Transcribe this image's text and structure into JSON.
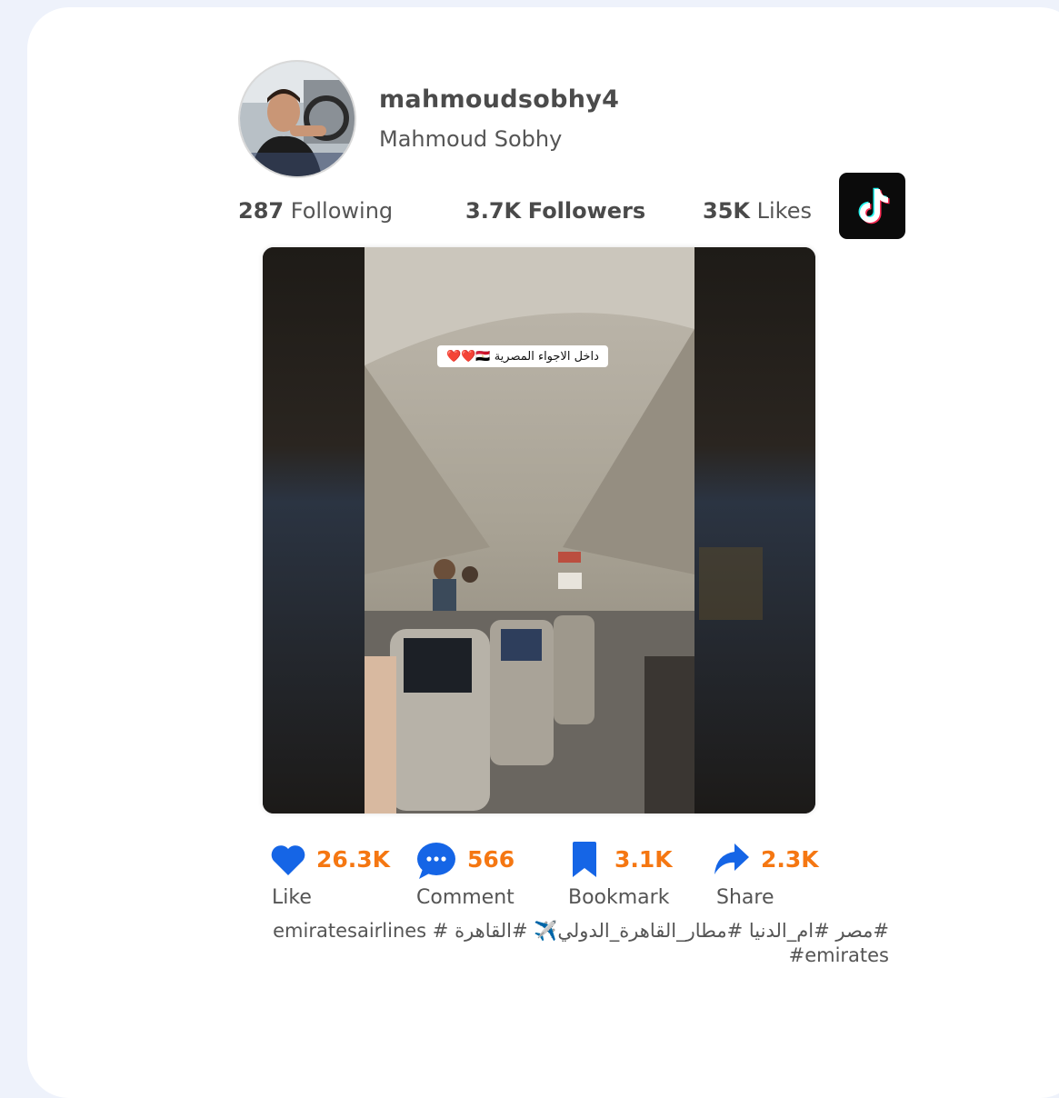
{
  "profile": {
    "username": "mahmoudsobhy4",
    "display_name": "Mahmoud Sobhy"
  },
  "stats": {
    "following_count": "287",
    "following_label": "Following",
    "followers_count": "3.7K",
    "followers_label": "Followers",
    "likes_count": "35K",
    "likes_label": "Likes"
  },
  "video": {
    "overlay_text": "داخل الاجواء المصرية 🇪🇬❤️❤️"
  },
  "metrics": {
    "like_count": "26.3K",
    "like_label": "Like",
    "comment_count": "566",
    "comment_label": "Comment",
    "bookmark_count": "3.1K",
    "bookmark_label": "Bookmark",
    "share_count": "2.3K",
    "share_label": "Share"
  },
  "description": "#مصر #ام_الدنيا #مطار_القاهرة_الدولي✈️ #القاهرة # emiratesairlines #emirates",
  "icons": {
    "like": "heart-icon",
    "comment": "speech-bubble-icon",
    "bookmark": "bookmark-icon",
    "share": "share-arrow-icon",
    "brand": "tiktok-logo-icon"
  },
  "colors": {
    "accent": "#f57712",
    "icon_blue": "#1565e6",
    "background": "#eef2fb"
  }
}
